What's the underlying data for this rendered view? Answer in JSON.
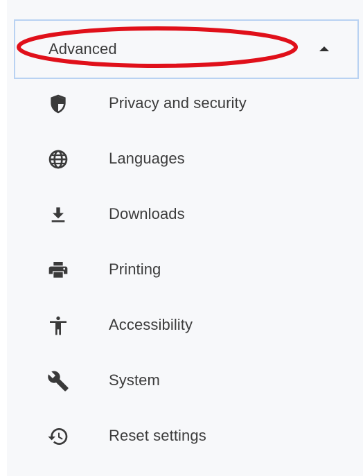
{
  "section": {
    "label": "Advanced",
    "expanded": true,
    "highlight_color": "#e0101a"
  },
  "items": [
    {
      "label": "Privacy and security",
      "icon": "shield-icon"
    },
    {
      "label": "Languages",
      "icon": "globe-icon"
    },
    {
      "label": "Downloads",
      "icon": "download-icon"
    },
    {
      "label": "Printing",
      "icon": "printer-icon"
    },
    {
      "label": "Accessibility",
      "icon": "accessibility-icon"
    },
    {
      "label": "System",
      "icon": "wrench-icon"
    },
    {
      "label": "Reset settings",
      "icon": "restore-history-icon"
    }
  ],
  "colors": {
    "text": "#3c3c3c",
    "icon": "#3a3a3a",
    "panel_background": "#f7f8fa",
    "header_border": "#b9d2f2"
  }
}
